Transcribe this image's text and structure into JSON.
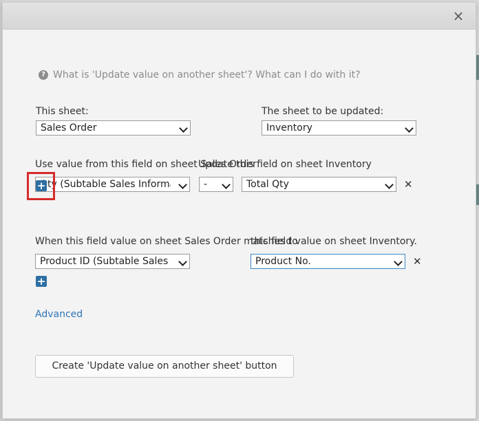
{
  "dialog": {
    "close_icon": "×",
    "help_text": "What is 'Update value on another sheet'? What can I do with it?",
    "help_icon": "?"
  },
  "sheets": {
    "this_sheet_label": "This sheet:",
    "this_sheet_value": "Sales Order",
    "target_sheet_label": "The sheet to be updated:",
    "target_sheet_value": "Inventory"
  },
  "mapping": {
    "source_label": "Use value from this field on sheet Sales Order",
    "target_label": "Update this field on sheet Inventory",
    "source_field": "Qty (Subtable Sales Information)",
    "operator": "-",
    "target_field": "Total Qty",
    "remove_icon": "✕",
    "add_icon": "+"
  },
  "matching": {
    "source_label": "When this field value on sheet Sales Order matches to",
    "target_label": "this field value on sheet Inventory.",
    "source_field": "Product ID (Subtable Sales Information)",
    "target_field": "Product No.",
    "remove_icon": "✕",
    "add_icon": "+"
  },
  "advanced_label": "Advanced",
  "create_button_label": "Create 'Update value on another sheet' button",
  "colors": {
    "accent": "#2e6fa3",
    "link": "#2e74b5",
    "highlight": "#d62a2a"
  }
}
